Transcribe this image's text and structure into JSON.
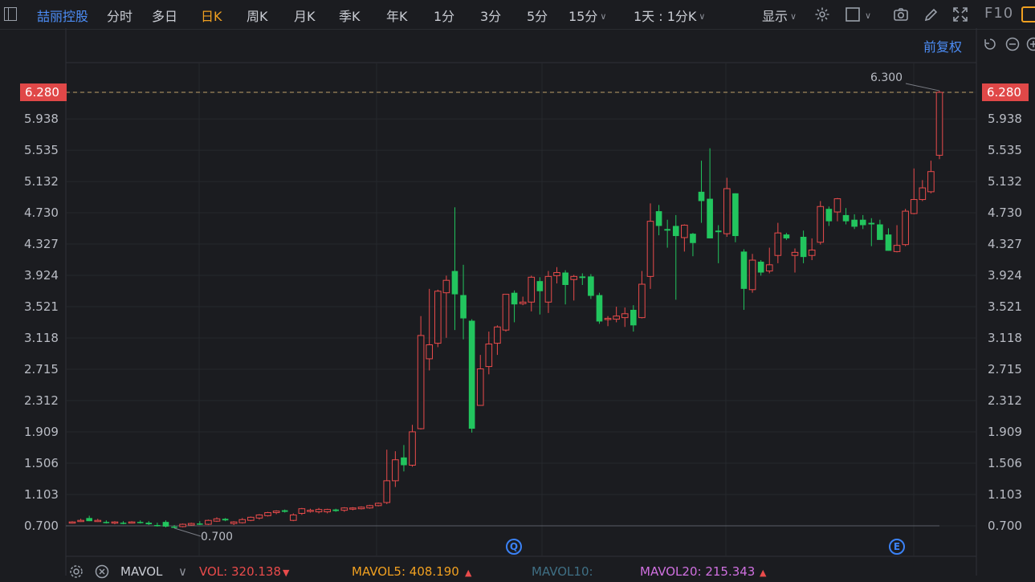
{
  "toolbar": {
    "stock_name": "喆丽控股",
    "items": [
      "分时",
      "多日",
      "日K",
      "周K",
      "月K",
      "季K",
      "年K",
      "1分",
      "3分",
      "5分",
      "15分"
    ],
    "interval_selector": "1天 : 1分K",
    "display_label": "显示",
    "f10_label": "F10"
  },
  "adjust_label": "前复权",
  "price_marker": "6.280",
  "peak_label": "6.300",
  "low_label": "0.700",
  "markers": {
    "q": "Q",
    "e": "E"
  },
  "bottom": {
    "mavol": "MAVOL",
    "vol": "VOL: 320.138",
    "mavol5": "MAVOL5: 408.190",
    "mavol10": "MAVOL10:",
    "mavol20": "MAVOL20: 215.343"
  },
  "colors": {
    "background": "#1b1c20",
    "up": "#e94b4b",
    "down": "#22c55e",
    "accent": "#f0a020",
    "link": "#4c8df6"
  },
  "icons": [
    "panel-icon",
    "gear-icon",
    "checkbox-icon",
    "camera-icon",
    "pencil-icon",
    "expand-icon",
    "reset-icon",
    "zoom-out-icon",
    "zoom-in-icon"
  ],
  "chart_data": {
    "type": "candlestick",
    "ytick_labels": [
      "6.280",
      "5.938",
      "5.535",
      "5.132",
      "4.730",
      "4.327",
      "3.924",
      "3.521",
      "3.118",
      "2.715",
      "2.312",
      "1.909",
      "1.506",
      "1.103",
      "0.700"
    ],
    "ylim": [
      0.7,
      6.28
    ],
    "current_price": 6.28,
    "high": 6.3,
    "low": 0.7,
    "candles": [
      {
        "o": 0.74,
        "h": 0.76,
        "l": 0.73,
        "c": 0.75
      },
      {
        "o": 0.76,
        "h": 0.79,
        "l": 0.75,
        "c": 0.77
      },
      {
        "o": 0.8,
        "h": 0.83,
        "l": 0.76,
        "c": 0.76
      },
      {
        "o": 0.76,
        "h": 0.79,
        "l": 0.75,
        "c": 0.77
      },
      {
        "o": 0.75,
        "h": 0.77,
        "l": 0.73,
        "c": 0.74
      },
      {
        "o": 0.74,
        "h": 0.76,
        "l": 0.72,
        "c": 0.75
      },
      {
        "o": 0.74,
        "h": 0.76,
        "l": 0.72,
        "c": 0.73
      },
      {
        "o": 0.74,
        "h": 0.76,
        "l": 0.73,
        "c": 0.75
      },
      {
        "o": 0.75,
        "h": 0.77,
        "l": 0.73,
        "c": 0.74
      },
      {
        "o": 0.74,
        "h": 0.76,
        "l": 0.71,
        "c": 0.72
      },
      {
        "o": 0.71,
        "h": 0.74,
        "l": 0.69,
        "c": 0.7
      },
      {
        "o": 0.75,
        "h": 0.77,
        "l": 0.68,
        "c": 0.69
      },
      {
        "o": 0.69,
        "h": 0.71,
        "l": 0.67,
        "c": 0.68
      },
      {
        "o": 0.69,
        "h": 0.73,
        "l": 0.68,
        "c": 0.72
      },
      {
        "o": 0.71,
        "h": 0.74,
        "l": 0.7,
        "c": 0.73
      },
      {
        "o": 0.73,
        "h": 0.76,
        "l": 0.71,
        "c": 0.72
      },
      {
        "o": 0.72,
        "h": 0.78,
        "l": 0.71,
        "c": 0.77
      },
      {
        "o": 0.76,
        "h": 0.81,
        "l": 0.75,
        "c": 0.79
      },
      {
        "o": 0.79,
        "h": 0.8,
        "l": 0.76,
        "c": 0.77
      },
      {
        "o": 0.73,
        "h": 0.76,
        "l": 0.71,
        "c": 0.75
      },
      {
        "o": 0.74,
        "h": 0.8,
        "l": 0.73,
        "c": 0.78
      },
      {
        "o": 0.77,
        "h": 0.82,
        "l": 0.76,
        "c": 0.81
      },
      {
        "o": 0.8,
        "h": 0.85,
        "l": 0.78,
        "c": 0.84
      },
      {
        "o": 0.83,
        "h": 0.88,
        "l": 0.82,
        "c": 0.87
      },
      {
        "o": 0.87,
        "h": 0.9,
        "l": 0.85,
        "c": 0.89
      },
      {
        "o": 0.9,
        "h": 0.91,
        "l": 0.87,
        "c": 0.88
      },
      {
        "o": 0.77,
        "h": 0.86,
        "l": 0.76,
        "c": 0.84
      },
      {
        "o": 0.86,
        "h": 0.93,
        "l": 0.84,
        "c": 0.92
      },
      {
        "o": 0.89,
        "h": 0.92,
        "l": 0.87,
        "c": 0.9
      },
      {
        "o": 0.88,
        "h": 0.93,
        "l": 0.86,
        "c": 0.91
      },
      {
        "o": 0.88,
        "h": 0.92,
        "l": 0.86,
        "c": 0.91
      },
      {
        "o": 0.91,
        "h": 0.92,
        "l": 0.88,
        "c": 0.89
      },
      {
        "o": 0.9,
        "h": 0.94,
        "l": 0.88,
        "c": 0.93
      },
      {
        "o": 0.92,
        "h": 0.94,
        "l": 0.9,
        "c": 0.93
      },
      {
        "o": 0.92,
        "h": 0.95,
        "l": 0.91,
        "c": 0.94
      },
      {
        "o": 0.93,
        "h": 0.97,
        "l": 0.92,
        "c": 0.96
      },
      {
        "o": 0.96,
        "h": 1.0,
        "l": 0.95,
        "c": 0.99
      },
      {
        "o": 1.0,
        "h": 1.68,
        "l": 0.98,
        "c": 1.28
      },
      {
        "o": 1.28,
        "h": 1.66,
        "l": 1.2,
        "c": 1.55
      },
      {
        "o": 1.58,
        "h": 1.74,
        "l": 1.4,
        "c": 1.48
      },
      {
        "o": 1.48,
        "h": 2.0,
        "l": 1.46,
        "c": 1.91
      },
      {
        "o": 1.95,
        "h": 3.4,
        "l": 1.94,
        "c": 3.15
      },
      {
        "o": 2.85,
        "h": 3.75,
        "l": 2.7,
        "c": 3.03
      },
      {
        "o": 3.05,
        "h": 3.74,
        "l": 3.0,
        "c": 3.72
      },
      {
        "o": 3.7,
        "h": 3.92,
        "l": 3.12,
        "c": 3.86
      },
      {
        "o": 3.98,
        "h": 4.8,
        "l": 3.22,
        "c": 3.68
      },
      {
        "o": 3.67,
        "h": 4.06,
        "l": 3.1,
        "c": 3.37
      },
      {
        "o": 3.34,
        "h": 3.36,
        "l": 1.9,
        "c": 1.95
      },
      {
        "o": 2.25,
        "h": 2.9,
        "l": 2.25,
        "c": 2.72
      },
      {
        "o": 2.75,
        "h": 3.2,
        "l": 2.65,
        "c": 3.04
      },
      {
        "o": 3.05,
        "h": 3.28,
        "l": 2.9,
        "c": 3.26
      },
      {
        "o": 3.22,
        "h": 3.68,
        "l": 3.2,
        "c": 3.68
      },
      {
        "o": 3.7,
        "h": 3.73,
        "l": 3.32,
        "c": 3.55
      },
      {
        "o": 3.56,
        "h": 3.65,
        "l": 3.54,
        "c": 3.58
      },
      {
        "o": 3.58,
        "h": 3.92,
        "l": 3.46,
        "c": 3.9
      },
      {
        "o": 3.85,
        "h": 3.9,
        "l": 3.42,
        "c": 3.72
      },
      {
        "o": 3.58,
        "h": 3.98,
        "l": 3.44,
        "c": 3.91
      },
      {
        "o": 3.92,
        "h": 4.03,
        "l": 3.82,
        "c": 3.96
      },
      {
        "o": 3.96,
        "h": 3.99,
        "l": 3.55,
        "c": 3.8
      },
      {
        "o": 3.87,
        "h": 3.93,
        "l": 3.6,
        "c": 3.91
      },
      {
        "o": 3.91,
        "h": 3.95,
        "l": 3.8,
        "c": 3.89
      },
      {
        "o": 3.91,
        "h": 3.94,
        "l": 3.62,
        "c": 3.66
      },
      {
        "o": 3.67,
        "h": 3.7,
        "l": 3.3,
        "c": 3.33
      },
      {
        "o": 3.36,
        "h": 3.4,
        "l": 3.27,
        "c": 3.37
      },
      {
        "o": 3.36,
        "h": 3.52,
        "l": 3.32,
        "c": 3.4
      },
      {
        "o": 3.38,
        "h": 3.51,
        "l": 3.26,
        "c": 3.43
      },
      {
        "o": 3.48,
        "h": 3.54,
        "l": 3.2,
        "c": 3.28
      },
      {
        "o": 3.38,
        "h": 3.98,
        "l": 3.37,
        "c": 3.81
      },
      {
        "o": 3.91,
        "h": 4.85,
        "l": 3.75,
        "c": 4.62
      },
      {
        "o": 4.75,
        "h": 4.83,
        "l": 4.44,
        "c": 4.56
      },
      {
        "o": 4.52,
        "h": 4.64,
        "l": 4.28,
        "c": 4.5
      },
      {
        "o": 4.56,
        "h": 4.7,
        "l": 3.61,
        "c": 4.43
      },
      {
        "o": 4.41,
        "h": 4.58,
        "l": 4.23,
        "c": 4.57
      },
      {
        "o": 4.46,
        "h": 4.47,
        "l": 4.17,
        "c": 4.34
      },
      {
        "o": 5.0,
        "h": 5.4,
        "l": 4.6,
        "c": 4.88
      },
      {
        "o": 4.91,
        "h": 5.56,
        "l": 4.4,
        "c": 4.4
      },
      {
        "o": 4.5,
        "h": 4.57,
        "l": 4.08,
        "c": 4.48
      },
      {
        "o": 4.46,
        "h": 5.18,
        "l": 4.42,
        "c": 5.04
      },
      {
        "o": 4.98,
        "h": 4.98,
        "l": 4.35,
        "c": 4.43
      },
      {
        "o": 4.23,
        "h": 4.26,
        "l": 3.48,
        "c": 3.75
      },
      {
        "o": 3.74,
        "h": 4.2,
        "l": 3.7,
        "c": 4.12
      },
      {
        "o": 4.1,
        "h": 4.12,
        "l": 3.92,
        "c": 3.96
      },
      {
        "o": 3.98,
        "h": 4.28,
        "l": 3.95,
        "c": 4.06
      },
      {
        "o": 4.18,
        "h": 4.6,
        "l": 4.08,
        "c": 4.47
      },
      {
        "o": 4.45,
        "h": 4.47,
        "l": 4.38,
        "c": 4.4
      },
      {
        "o": 4.18,
        "h": 4.27,
        "l": 3.96,
        "c": 4.22
      },
      {
        "o": 4.42,
        "h": 4.5,
        "l": 4.08,
        "c": 4.16
      },
      {
        "o": 4.18,
        "h": 4.4,
        "l": 4.12,
        "c": 4.25
      },
      {
        "o": 4.35,
        "h": 4.88,
        "l": 4.32,
        "c": 4.81
      },
      {
        "o": 4.78,
        "h": 4.81,
        "l": 4.56,
        "c": 4.62
      },
      {
        "o": 4.74,
        "h": 4.92,
        "l": 4.62,
        "c": 4.91
      },
      {
        "o": 4.7,
        "h": 4.79,
        "l": 4.58,
        "c": 4.62
      },
      {
        "o": 4.64,
        "h": 4.71,
        "l": 4.52,
        "c": 4.55
      },
      {
        "o": 4.64,
        "h": 4.7,
        "l": 4.52,
        "c": 4.57
      },
      {
        "o": 4.6,
        "h": 4.66,
        "l": 4.3,
        "c": 4.58
      },
      {
        "o": 4.58,
        "h": 4.64,
        "l": 4.4,
        "c": 4.38
      },
      {
        "o": 4.45,
        "h": 4.53,
        "l": 4.24,
        "c": 4.24
      },
      {
        "o": 4.23,
        "h": 4.57,
        "l": 4.22,
        "c": 4.31
      },
      {
        "o": 4.32,
        "h": 4.78,
        "l": 4.3,
        "c": 4.75
      },
      {
        "o": 4.72,
        "h": 5.3,
        "l": 4.71,
        "c": 4.9
      },
      {
        "o": 4.9,
        "h": 5.15,
        "l": 4.88,
        "c": 5.05
      },
      {
        "o": 5.0,
        "h": 5.4,
        "l": 4.98,
        "c": 5.26
      },
      {
        "o": 5.47,
        "h": 6.3,
        "l": 5.42,
        "c": 6.28
      }
    ]
  }
}
